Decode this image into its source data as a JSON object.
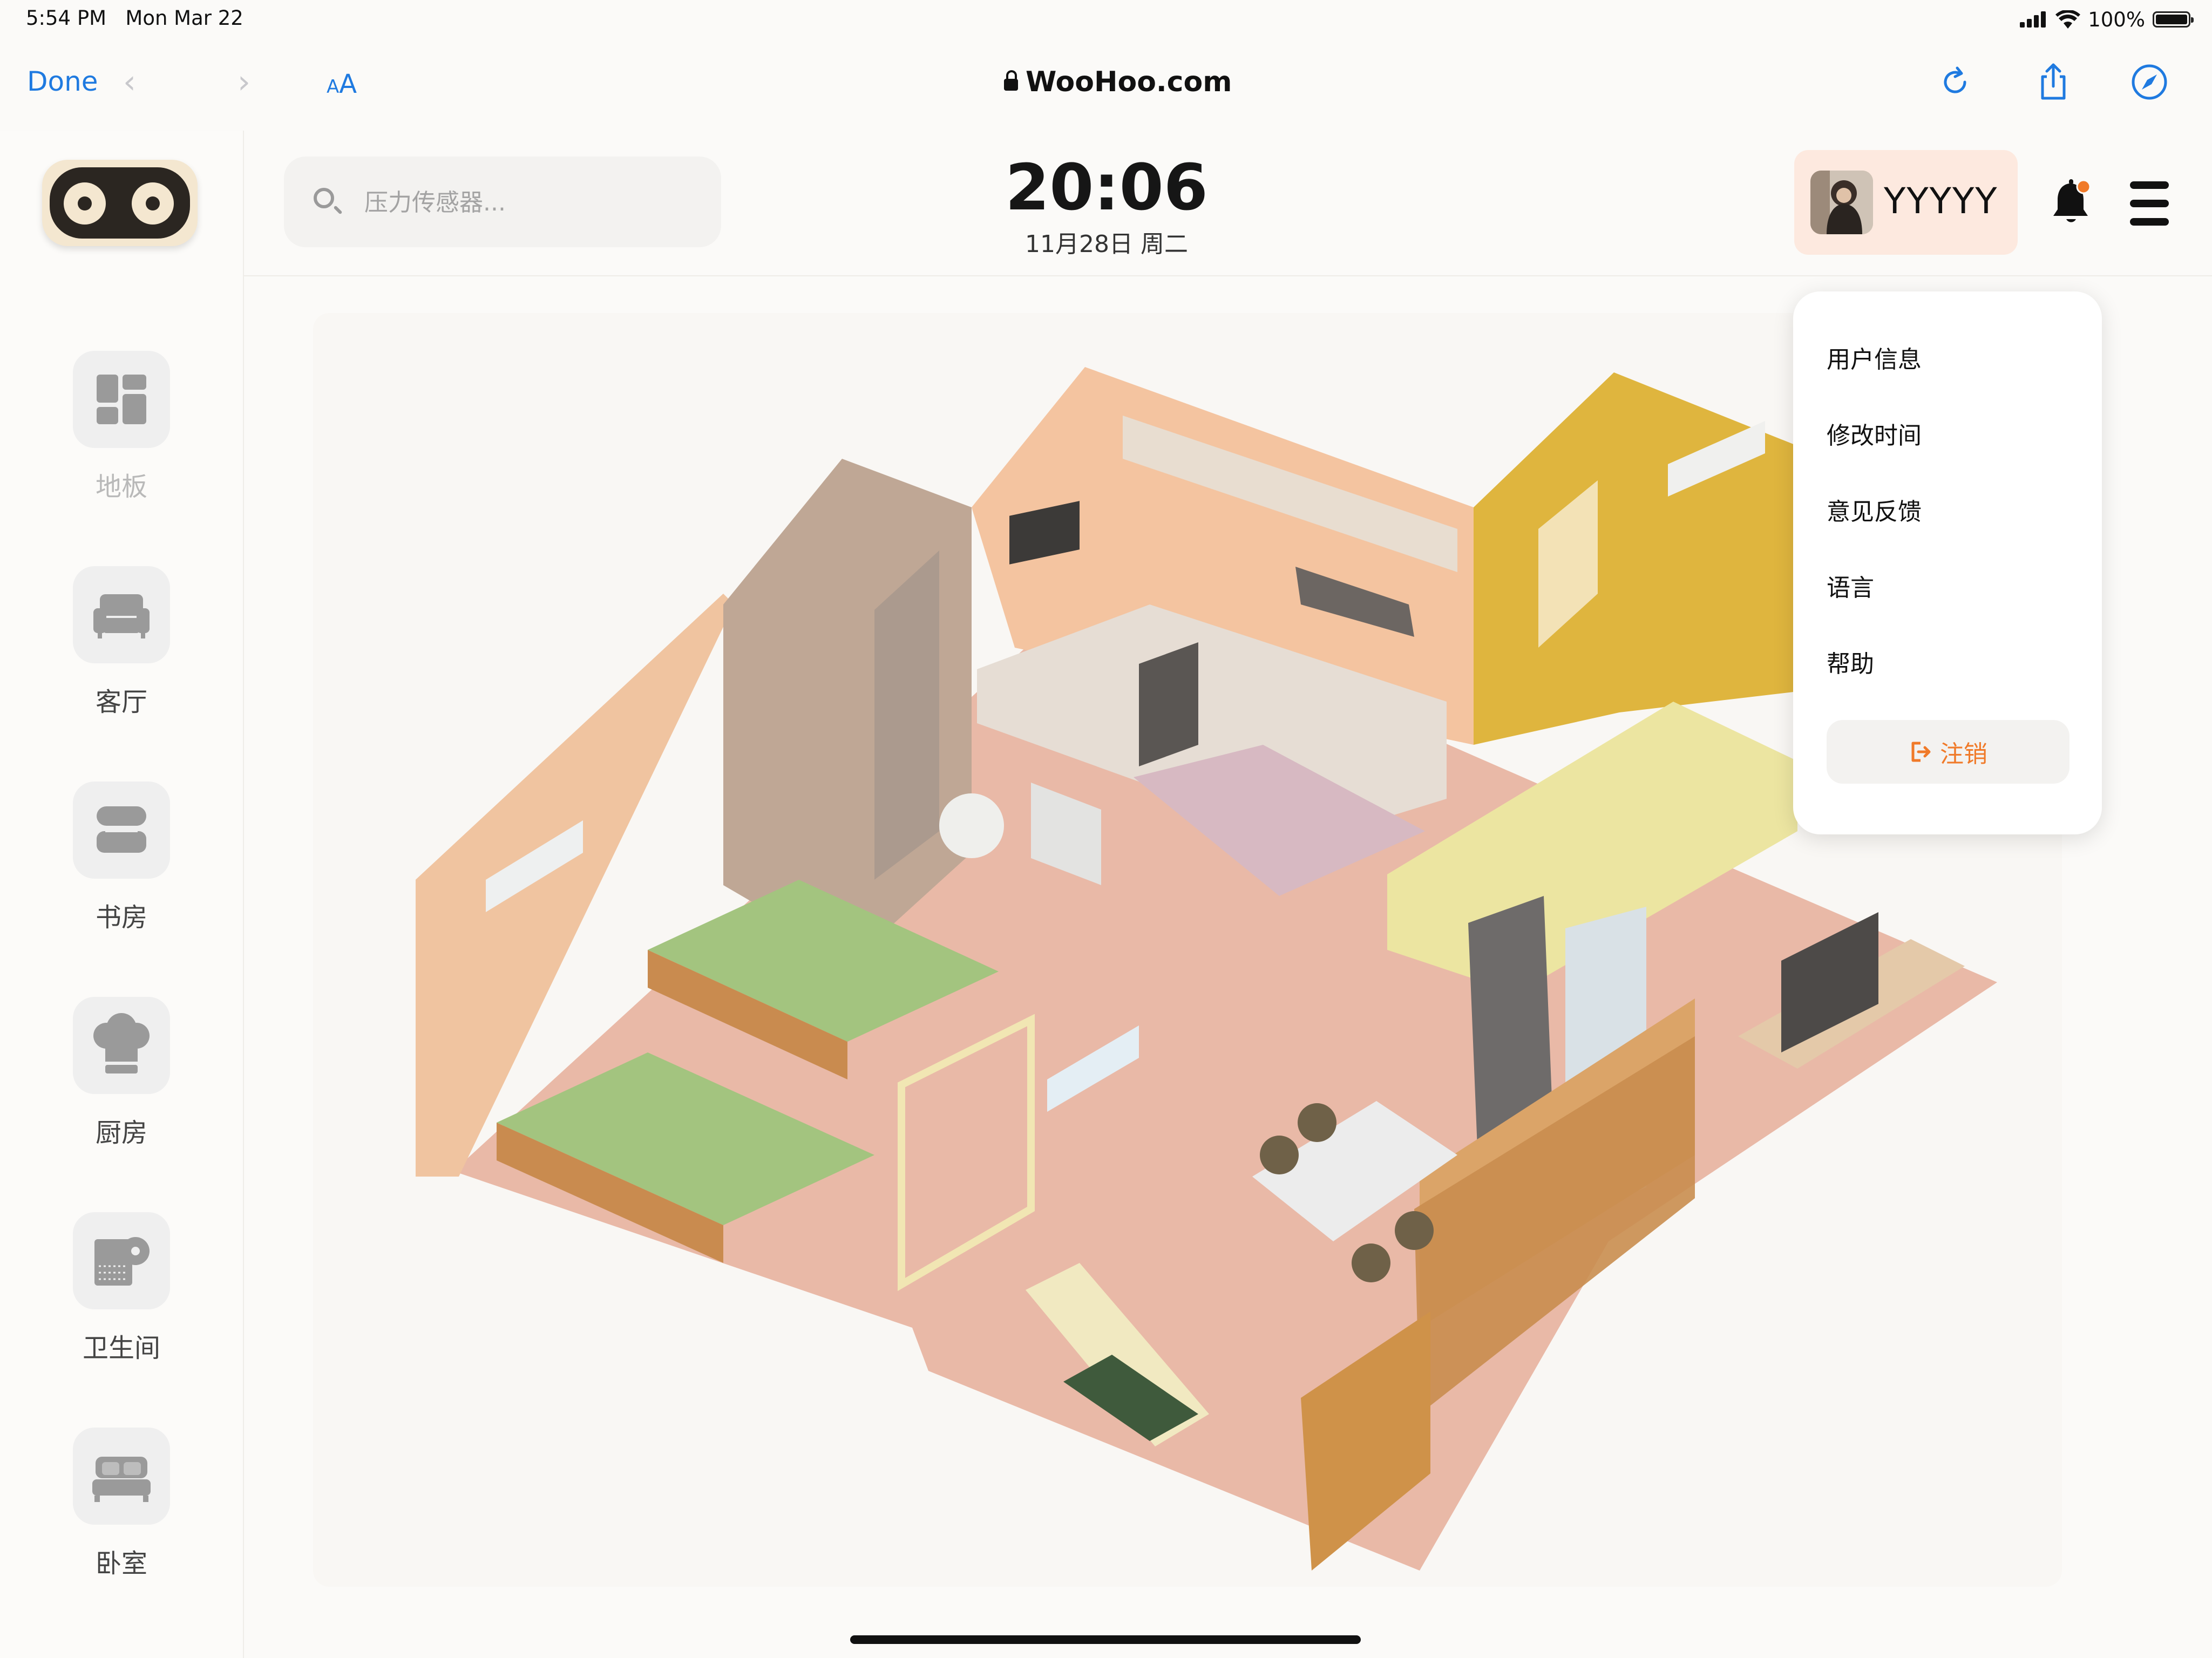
{
  "status_bar": {
    "time": "5:54 PM",
    "date": "Mon Mar 22",
    "battery": "100%"
  },
  "browser": {
    "done_label": "Done",
    "url": "WooHoo.com",
    "reader_label_small": "A",
    "reader_label_large": "A",
    "accent": "#1f7ae0"
  },
  "sidebar": {
    "items": [
      {
        "label": "地板",
        "icon": "floor-grid-icon",
        "active": false
      },
      {
        "label": "客厅",
        "icon": "sofa-icon",
        "active": true
      },
      {
        "label": "书房",
        "icon": "books-icon",
        "active": true
      },
      {
        "label": "厨房",
        "icon": "chef-hat-icon",
        "active": true
      },
      {
        "label": "卫生间",
        "icon": "toilet-paper-icon",
        "active": true
      },
      {
        "label": "卧室",
        "icon": "bed-icon",
        "active": true
      }
    ]
  },
  "header": {
    "search_placeholder": "压力传感器...",
    "time": "20:06",
    "date": "11月28日 周二",
    "username": "YYYYY",
    "notification_dot_color": "#f07a29"
  },
  "user_menu": {
    "items": [
      "用户信息",
      "修改时间",
      "意见反馈",
      "语言",
      "帮助"
    ],
    "logout_label": "注销",
    "logout_color": "#f07a29"
  },
  "floorplan": {
    "wall_color": "#f1c9a8",
    "floor_color": "#e9b8a5",
    "accent_wall": "#e2b53c",
    "bed_color": "#9cc17a"
  }
}
